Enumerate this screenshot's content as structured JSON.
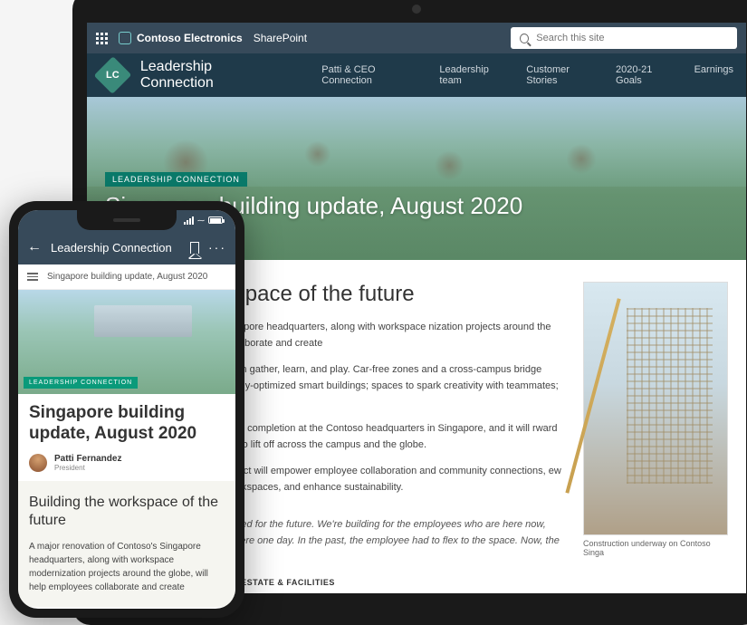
{
  "chrome": {
    "brand": "Contoso Electronics",
    "product": "SharePoint",
    "search_placeholder": "Search this site"
  },
  "site": {
    "logo_text": "LC",
    "title": "Leadership Connection",
    "nav": [
      "Patti & CEO Connection",
      "Leadership team",
      "Customer Stories",
      "2020-21 Goals",
      "Earnings"
    ]
  },
  "hero": {
    "tag": "LEADERSHIP CONNECTION",
    "title": "Singapore building update, August 2020",
    "author": "i Fernandez",
    "role": "ent"
  },
  "article": {
    "heading": "ding the workspace of the future",
    "p1": "r renovation of Contoso's Singapore headquarters, along with workspace nization projects around the globe, will help employees collaborate and create",
    "p2": "nity plaza where employees can gather, learn, and play. Car-free zones and a cross-campus bridge edestrians and bicyclists. Energy-optimized smart buildings; spaces to spark creativity with teammates; ls, and transit close at hand.",
    "p3": "major redevelopment is nearing completion at the Contoso headquarters in Singapore, and it will rward a modern vision of workspace to lift off across the campus and the globe.",
    "p4": "nology-fueled, multiphase project will empower employee collaboration and community connections, ew buildings, upgrade existing workspaces, and enhance sustainability.",
    "quote": "uilding the kind of space we need for the future. We're building for the employees who are here now, and ghth graders who will be here one day. In the past, the employee had to flex to the space. Now, the space the employee.",
    "attribution": "CILIANI, GM OF GLOBAL REAL ESTATE & FACILITIES",
    "aside_caption": "Construction underway on Contoso Singa"
  },
  "phone": {
    "header_title": "Leadership Connection",
    "subtitle": "Singapore building update, August 2020",
    "hero_tag": "LEADERSHIP CONNECTION",
    "article_title": "Singapore building update, August 2020",
    "author_name": "Patti Fernandez",
    "author_role": "President",
    "body_heading": "Building the workspace of the future",
    "body_text": "A major renovation of Contoso's Singapore headquarters, along with workspace modernization projects around the globe, will help employees collaborate and create"
  }
}
